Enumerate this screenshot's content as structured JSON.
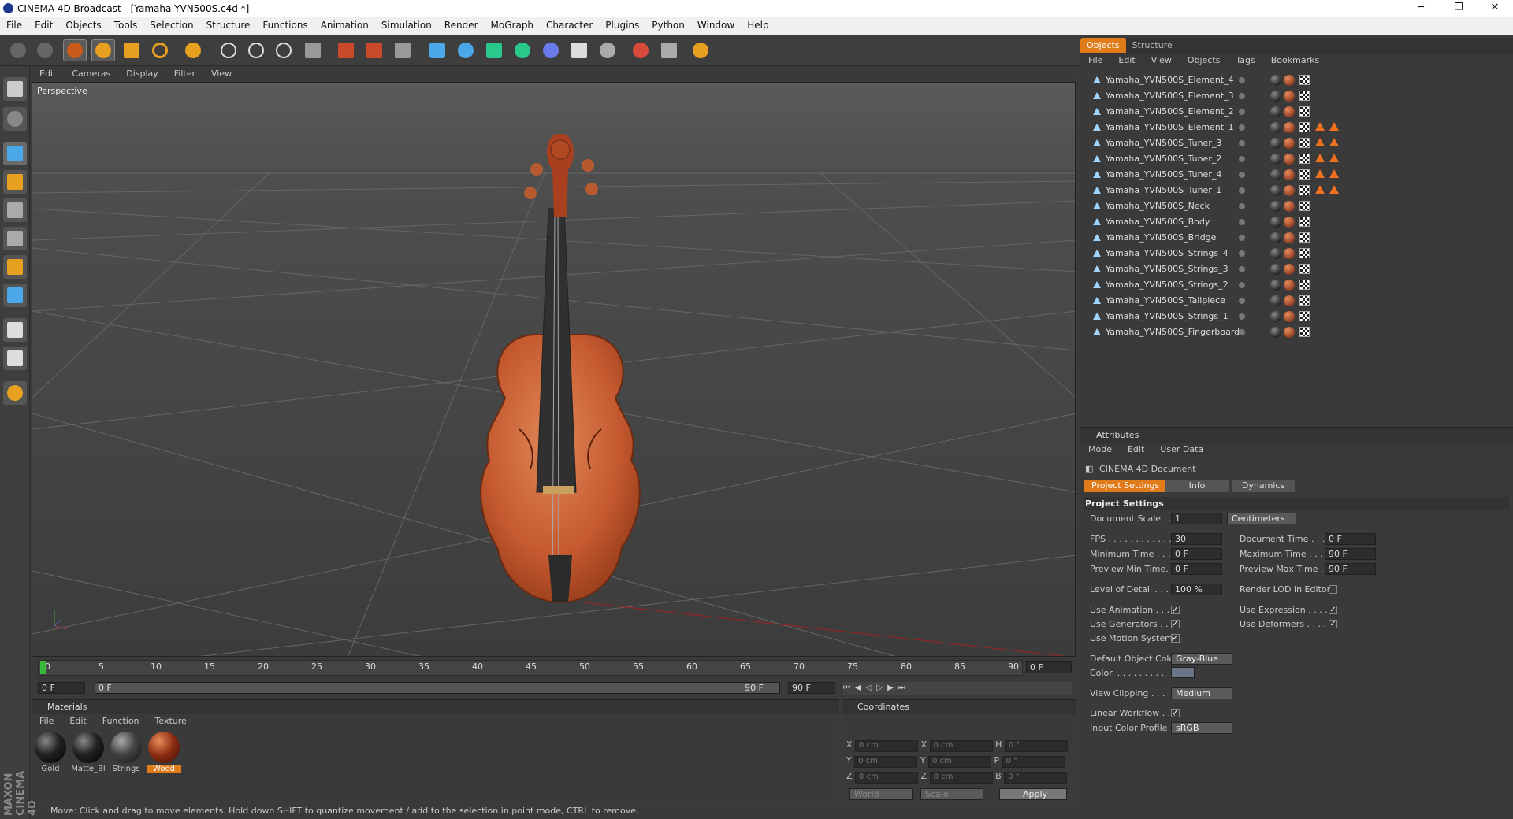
{
  "window": {
    "title": "CINEMA 4D Broadcast - [Yamaha YVN500S.c4d *]",
    "minimize": "─",
    "maximize": "❐",
    "close": "✕"
  },
  "menu": [
    "File",
    "Edit",
    "Objects",
    "Tools",
    "Selection",
    "Structure",
    "Functions",
    "Animation",
    "Simulation",
    "Render",
    "MoGraph",
    "Character",
    "Plugins",
    "Python",
    "Window",
    "Help"
  ],
  "viewport": {
    "menu": [
      "Edit",
      "Cameras",
      "Display",
      "Filter",
      "View"
    ],
    "label": "Perspective"
  },
  "timeline": {
    "ticks": [
      "0",
      "5",
      "10",
      "15",
      "20",
      "25",
      "30",
      "35",
      "40",
      "45",
      "50",
      "55",
      "60",
      "65",
      "70",
      "75",
      "80",
      "85",
      "90"
    ],
    "current_frame": "0 F",
    "start": "0 F",
    "range_start": "0 F",
    "range_end": "90 F",
    "end": "90 F"
  },
  "materials": {
    "title": "Materials",
    "menu": [
      "File",
      "Edit",
      "Function",
      "Texture"
    ],
    "items": [
      {
        "name": "Gold",
        "color": "#000000"
      },
      {
        "name": "Matte_Bl",
        "color": "#000000"
      },
      {
        "name": "Strings",
        "color": "#3a3a3a"
      },
      {
        "name": "Wood",
        "color": "#7a2a10"
      }
    ]
  },
  "coordinates": {
    "title": "Coordinates",
    "rows": [
      {
        "a": "X",
        "av": "0 cm",
        "b": "X",
        "bv": "0 cm",
        "c": "H",
        "cv": "0 °"
      },
      {
        "a": "Y",
        "av": "0 cm",
        "b": "Y",
        "bv": "0 cm",
        "c": "P",
        "cv": "0 °"
      },
      {
        "a": "Z",
        "av": "0 cm",
        "b": "Z",
        "bv": "0 cm",
        "c": "B",
        "cv": "0 °"
      }
    ],
    "world": "World",
    "scale": "Scale",
    "apply": "Apply"
  },
  "objects_panel": {
    "tabs": [
      "Objects",
      "Structure"
    ],
    "menu": [
      "File",
      "Edit",
      "View",
      "Objects",
      "Tags",
      "Bookmarks"
    ],
    "items": [
      {
        "name": "Yamaha_YVN500S_Element_4",
        "warn": false
      },
      {
        "name": "Yamaha_YVN500S_Element_3",
        "warn": false
      },
      {
        "name": "Yamaha_YVN500S_Element_2",
        "warn": false
      },
      {
        "name": "Yamaha_YVN500S_Element_1",
        "warn": true
      },
      {
        "name": "Yamaha_YVN500S_Tuner_3",
        "warn": true
      },
      {
        "name": "Yamaha_YVN500S_Tuner_2",
        "warn": true
      },
      {
        "name": "Yamaha_YVN500S_Tuner_4",
        "warn": true
      },
      {
        "name": "Yamaha_YVN500S_Tuner_1",
        "warn": true
      },
      {
        "name": "Yamaha_YVN500S_Neck",
        "warn": false
      },
      {
        "name": "Yamaha_YVN500S_Body",
        "warn": false
      },
      {
        "name": "Yamaha_YVN500S_Bridge",
        "warn": false
      },
      {
        "name": "Yamaha_YVN500S_Strings_4",
        "warn": false
      },
      {
        "name": "Yamaha_YVN500S_Strings_3",
        "warn": false
      },
      {
        "name": "Yamaha_YVN500S_Strings_2",
        "warn": false
      },
      {
        "name": "Yamaha_YVN500S_Tailpiece",
        "warn": false
      },
      {
        "name": "Yamaha_YVN500S_Strings_1",
        "warn": false
      },
      {
        "name": "Yamaha_YVN500S_Fingerboard",
        "warn": false
      }
    ]
  },
  "attributes": {
    "title": "Attributes",
    "menu": [
      "Mode",
      "Edit",
      "User Data"
    ],
    "doc": "CINEMA 4D Document",
    "tabs": [
      "Project Settings",
      "Info",
      "Dynamics"
    ],
    "section": "Project Settings",
    "document_scale_label": "Document Scale . .",
    "document_scale": "1",
    "scale_unit": "Centimeters",
    "fps_label": "FPS . . . . . . . . . . . . .",
    "fps": "30",
    "doc_time_label": "Document Time . . .",
    "doc_time": "0 F",
    "min_time_label": "Minimum Time . . . .",
    "min_time": "0 F",
    "max_time_label": "Maximum Time . . . .",
    "max_time": "90 F",
    "prev_min_label": "Preview Min Time. .",
    "prev_min": "0 F",
    "prev_max_label": "Preview Max Time . .",
    "prev_max": "90 F",
    "lod_label": "Level of Detail . . .",
    "lod": "100 %",
    "render_lod_label": "Render LOD in Editor",
    "use_anim_label": "Use Animation . . . .",
    "use_expr_label": "Use Expression . . . .",
    "use_gen_label": "Use Generators . . .",
    "use_def_label": "Use Deformers . . . .",
    "use_motion_label": "Use Motion System",
    "def_color_label": "Default Object Color",
    "def_color": "Gray-Blue",
    "color_label": "Color. . . . . . . . . .",
    "view_clip_label": "View Clipping . . . . .",
    "view_clip": "Medium",
    "linear_label": "Linear Workflow . . .",
    "icp_label": "Input Color Profile . .",
    "icp": "sRGB",
    "checkmark": "✓"
  },
  "status": "Move: Click and drag to move elements. Hold down SHIFT to quantize movement / add to the selection in point mode, CTRL to remove.",
  "brand": "MAXON CINEMA 4D",
  "colors": {
    "accent": "#e07b1a",
    "bg": "#3a3a3a",
    "viewport": "#535353"
  }
}
